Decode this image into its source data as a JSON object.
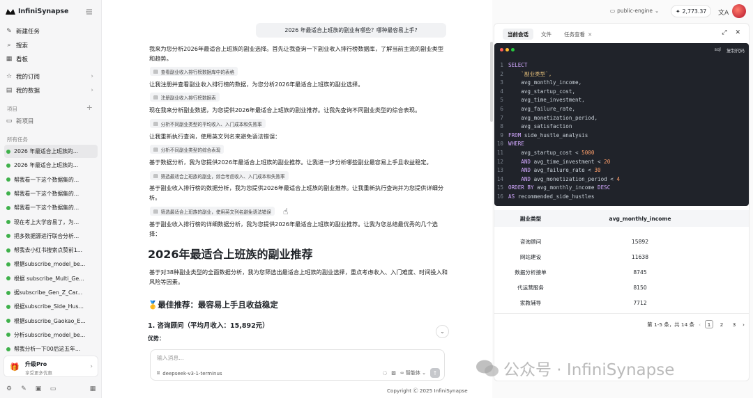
{
  "sidebar": {
    "brand": "InfiniSynapse",
    "nav": [
      {
        "icon": "edit-icon",
        "label": "新建任务"
      },
      {
        "icon": "search-icon",
        "label": "搜索"
      },
      {
        "icon": "grid-icon",
        "label": "看板"
      },
      {
        "icon": "star-icon",
        "label": "我的订阅"
      },
      {
        "icon": "database-icon",
        "label": "我的数据"
      }
    ],
    "projects_label": "项目",
    "new_project": "新项目",
    "tasks_label": "所有任务",
    "tasks": [
      "2026 年最适合上班族的...",
      "2026 年最适合上班族的...",
      "帮我看一下这个数据集的...",
      "帮我看一下这个数据集的...",
      "帮我看一下这个数据集的...",
      "现在考上大学容易了，为...",
      "把多数据源进行联合分析...",
      "帮我去小红书搜索点赞前1...",
      "根据subscribe_model_be...",
      "根据 subscribe_Multi_Ge...",
      "据subscribe_Gen_Z_Car...",
      "根据subscribe_Side_Hus...",
      "根据subscribe_Gaokao_E...",
      "分析subscribe_model_be...",
      "帮我分析一下00后这五年..."
    ],
    "upgrade_title": "升级Pro",
    "upgrade_sub": "享受更多优惠"
  },
  "topbar": {
    "engine": "public-engine",
    "credits": "2,773.37"
  },
  "chat": {
    "question": "2026 年最适合上班族的副业有哪些？哪种最容易上手?",
    "messages": [
      "我来为您分析2026年最适合上班族的副业选择。首先让我查询一下副业收入排行榜数据库，了解当前主流的副业类型和趋势。",
      "让我注册并查看副业收入排行榜的数据，为您分析2026年最适合上班族的副业选择。",
      "现在我来分析副业数据，为您提供2026年最适合上班族的副业推荐。让我先查询不同副业类型的综合表现。",
      "让我重新执行查询，使用英文列名来避免语法错误：",
      "基于数据分析，我为您提供2026年最适合上班族的副业推荐。让我进一步分析哪些副业最容易上手且收益稳定。",
      "基于副业收入排行榜的数据分析，我为您提供2026年最适合上班族的副业推荐。让我重新执行查询并为您提供详细分析。",
      "基于副业收入排行榜的详细数据分析，我为您提供2026年最适合上班族的副业推荐。让我为您总结最优秀的几个选择："
    ],
    "tools": [
      "查看副业收入排行榜数据库中的表格",
      "注册副业收入排行榜数据表",
      "分析不同副业类型的平均收入、入门成本和失败率",
      "分析不同副业类型的综合表现",
      "筛选最适合上班族的副业，综合考虑收入、入门成本和失败率",
      "筛选最适合上班族的副业，使用英文列名避免语法错误"
    ],
    "heading": "2026年最适合上班族的副业推荐",
    "intro": "基于对38种副业类型的全面数据分析，我为您筛选出最适合上班族的副业选择，重点考虑收入、入门难度、时间投入和风险等因素。",
    "best": "🥇最佳推荐：最容易上手且收益稳定",
    "item1": "1. 咨询顾问（平均月收入：15,892元）",
    "advantages": "优势：",
    "composer_placeholder": "输入消息...",
    "model": "deepseek-v3-1-terminus",
    "agent_mode": "智能体",
    "copyright": "Copyright Ⓒ 2025 InfiniSynapse"
  },
  "panel": {
    "tabs": [
      "当前会话",
      "文件",
      "任务查看"
    ],
    "code_lang": "sql",
    "copy_code": "复制代码",
    "code": [
      [
        {
          "t": "SELECT",
          "c": "kw"
        }
      ],
      [
        {
          "t": "    `副业类型`,",
          "c": "str"
        }
      ],
      [
        {
          "t": "    avg_monthly_income,",
          "c": ""
        }
      ],
      [
        {
          "t": "    avg_startup_cost,",
          "c": ""
        }
      ],
      [
        {
          "t": "    avg_time_investment,",
          "c": ""
        }
      ],
      [
        {
          "t": "    avg_failure_rate,",
          "c": ""
        }
      ],
      [
        {
          "t": "    avg_monetization_period,",
          "c": ""
        }
      ],
      [
        {
          "t": "    avg_satisfaction",
          "c": ""
        }
      ],
      [
        {
          "t": "FROM ",
          "c": "kw"
        },
        {
          "t": "side_hustle_analysis",
          "c": ""
        }
      ],
      [
        {
          "t": "WHERE",
          "c": "kw"
        }
      ],
      [
        {
          "t": "    avg_startup_cost < ",
          "c": ""
        },
        {
          "t": "5000",
          "c": "num"
        }
      ],
      [
        {
          "t": "    AND ",
          "c": "kw"
        },
        {
          "t": "avg_time_investment < ",
          "c": ""
        },
        {
          "t": "20",
          "c": "num"
        }
      ],
      [
        {
          "t": "    AND ",
          "c": "kw"
        },
        {
          "t": "avg_failure_rate < ",
          "c": ""
        },
        {
          "t": "30",
          "c": "num"
        }
      ],
      [
        {
          "t": "    AND ",
          "c": "kw"
        },
        {
          "t": "avg_monetization_period < ",
          "c": ""
        },
        {
          "t": "4",
          "c": "num"
        }
      ],
      [
        {
          "t": "ORDER BY ",
          "c": "kw"
        },
        {
          "t": "avg_monthly_income ",
          "c": ""
        },
        {
          "t": "DESC",
          "c": "kw"
        }
      ],
      [
        {
          "t": "AS ",
          "c": "kw"
        },
        {
          "t": "recommended_side_hustles",
          "c": ""
        }
      ]
    ],
    "table": {
      "columns": [
        "副业类型",
        "avg_monthly_income"
      ],
      "rows": [
        [
          "咨询顾问",
          "15892"
        ],
        [
          "网站建设",
          "11638"
        ],
        [
          "数据分析接单",
          "8745"
        ],
        [
          "代运营服务",
          "8150"
        ],
        [
          "家教辅导",
          "7712"
        ]
      ]
    },
    "pager": {
      "summary": "第 1-5 条，共 14 条",
      "pages": [
        "1",
        "2",
        "3"
      ],
      "current": "1"
    }
  },
  "watermark": "公众号 · InfiniSynapse"
}
